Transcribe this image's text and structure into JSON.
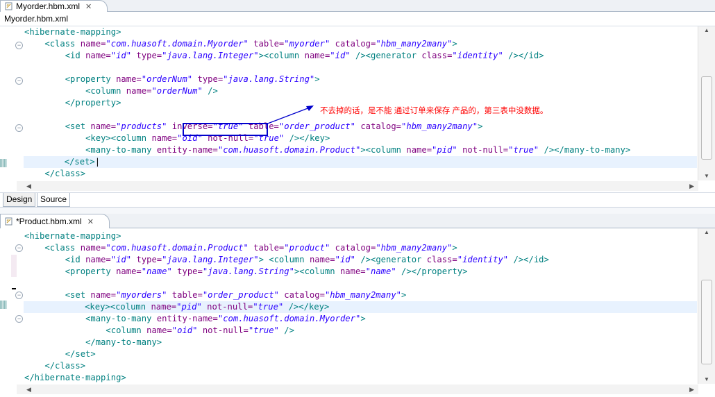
{
  "top_editor": {
    "tab_title": "Myorder.hbm.xml",
    "header_title": "Myorder.hbm.xml",
    "lines": [
      [
        [
          "tg",
          "<hibernate-mapping>"
        ]
      ],
      [
        [
          "pl",
          "    "
        ],
        [
          "tg",
          "<class "
        ],
        [
          "at",
          "name="
        ],
        [
          "st",
          "\"com.huasoft.domain.Myorder\""
        ],
        [
          "pl",
          " "
        ],
        [
          "at",
          "table="
        ],
        [
          "st",
          "\"myorder\""
        ],
        [
          "pl",
          " "
        ],
        [
          "at",
          "catalog="
        ],
        [
          "st",
          "\"hbm_many2many\""
        ],
        [
          "tg",
          ">"
        ]
      ],
      [
        [
          "pl",
          "        "
        ],
        [
          "tg",
          "<id "
        ],
        [
          "at",
          "name="
        ],
        [
          "st",
          "\"id\""
        ],
        [
          "pl",
          " "
        ],
        [
          "at",
          "type="
        ],
        [
          "st",
          "\"java.lang.Integer\""
        ],
        [
          "tg",
          "><column "
        ],
        [
          "at",
          "name="
        ],
        [
          "st",
          "\"id\""
        ],
        [
          "pl",
          " "
        ],
        [
          "tg",
          "/><generator "
        ],
        [
          "at",
          "class="
        ],
        [
          "st",
          "\"identity\""
        ],
        [
          "pl",
          " "
        ],
        [
          "tg",
          "/></id>"
        ]
      ],
      [
        [
          "pl",
          " "
        ]
      ],
      [
        [
          "pl",
          "        "
        ],
        [
          "tg",
          "<property "
        ],
        [
          "at",
          "name="
        ],
        [
          "st",
          "\"orderNum\""
        ],
        [
          "pl",
          " "
        ],
        [
          "at",
          "type="
        ],
        [
          "st",
          "\"java.lang.String\""
        ],
        [
          "tg",
          ">"
        ]
      ],
      [
        [
          "pl",
          "            "
        ],
        [
          "tg",
          "<column "
        ],
        [
          "at",
          "name="
        ],
        [
          "st",
          "\"orderNum\""
        ],
        [
          "pl",
          " "
        ],
        [
          "tg",
          "/>"
        ]
      ],
      [
        [
          "pl",
          "        "
        ],
        [
          "tg",
          "</property>"
        ]
      ],
      [
        [
          "pl",
          " "
        ]
      ],
      [
        [
          "pl",
          "        "
        ],
        [
          "tg",
          "<set "
        ],
        [
          "at",
          "name="
        ],
        [
          "st",
          "\"products\""
        ],
        [
          "pl",
          " "
        ],
        [
          "at",
          "inverse="
        ],
        [
          "st",
          "\"true\""
        ],
        [
          "pl",
          " "
        ],
        [
          "at",
          "table="
        ],
        [
          "st",
          "\"order_product\""
        ],
        [
          "pl",
          " "
        ],
        [
          "at",
          "catalog="
        ],
        [
          "st",
          "\"hbm_many2many\""
        ],
        [
          "tg",
          ">"
        ]
      ],
      [
        [
          "pl",
          "            "
        ],
        [
          "tg",
          "<key><column "
        ],
        [
          "at",
          "name="
        ],
        [
          "st",
          "\"oid\""
        ],
        [
          "pl",
          " "
        ],
        [
          "at",
          "not-null="
        ],
        [
          "st",
          "\"true\""
        ],
        [
          "pl",
          " "
        ],
        [
          "tg",
          "/></key>"
        ]
      ],
      [
        [
          "pl",
          "            "
        ],
        [
          "tg",
          "<many-to-many "
        ],
        [
          "at",
          "entity-name="
        ],
        [
          "st",
          "\"com.huasoft.domain.Product\""
        ],
        [
          "tg",
          "><column "
        ],
        [
          "at",
          "name="
        ],
        [
          "st",
          "\"pid\""
        ],
        [
          "pl",
          " "
        ],
        [
          "at",
          "not-null="
        ],
        [
          "st",
          "\"true\""
        ],
        [
          "pl",
          " "
        ],
        [
          "tg",
          "/></many-to-many>"
        ]
      ],
      [
        [
          "pl",
          "        "
        ],
        [
          "tg",
          "</set>"
        ],
        [
          "pl",
          "|"
        ]
      ],
      [
        [
          "pl",
          "    "
        ],
        [
          "tg",
          "</class>"
        ]
      ]
    ],
    "annotation": "不去掉的话，是不能 通过订单来保存 产品的，第三表中没数据。",
    "annotation_color": "#ff0000",
    "highlight_color": "#0000cc"
  },
  "bottom_tabs": {
    "design": "Design",
    "source": "Source"
  },
  "bottom_editor": {
    "tab_title": "*Product.hbm.xml",
    "lines": [
      [
        [
          "tg",
          "<hibernate-mapping>"
        ]
      ],
      [
        [
          "pl",
          "    "
        ],
        [
          "tg",
          "<class "
        ],
        [
          "at",
          "name="
        ],
        [
          "st",
          "\"com.huasoft.domain.Product\""
        ],
        [
          "pl",
          " "
        ],
        [
          "at",
          "table="
        ],
        [
          "st",
          "\"product\""
        ],
        [
          "pl",
          " "
        ],
        [
          "at",
          "catalog="
        ],
        [
          "st",
          "\"hbm_many2many\""
        ],
        [
          "tg",
          ">"
        ]
      ],
      [
        [
          "pl",
          "        "
        ],
        [
          "tg",
          "<id "
        ],
        [
          "at",
          "name="
        ],
        [
          "st",
          "\"id\""
        ],
        [
          "pl",
          " "
        ],
        [
          "at",
          "type="
        ],
        [
          "st",
          "\"java.lang.Integer\""
        ],
        [
          "tg",
          "> <column "
        ],
        [
          "at",
          "name="
        ],
        [
          "st",
          "\"id\""
        ],
        [
          "pl",
          " "
        ],
        [
          "tg",
          "/><generator "
        ],
        [
          "at",
          "class="
        ],
        [
          "st",
          "\"identity\""
        ],
        [
          "pl",
          " "
        ],
        [
          "tg",
          "/></id>"
        ]
      ],
      [
        [
          "pl",
          "        "
        ],
        [
          "tg",
          "<property "
        ],
        [
          "at",
          "name="
        ],
        [
          "st",
          "\"name\""
        ],
        [
          "pl",
          " "
        ],
        [
          "at",
          "type="
        ],
        [
          "st",
          "\"java.lang.String\""
        ],
        [
          "tg",
          "><column "
        ],
        [
          "at",
          "name="
        ],
        [
          "st",
          "\"name\""
        ],
        [
          "pl",
          " "
        ],
        [
          "tg",
          "/></property>"
        ]
      ],
      [
        [
          "pl",
          " "
        ]
      ],
      [
        [
          "pl",
          "        "
        ],
        [
          "tg",
          "<set "
        ],
        [
          "at",
          "name="
        ],
        [
          "st",
          "\"myorders\""
        ],
        [
          "pl",
          " "
        ],
        [
          "at",
          "table="
        ],
        [
          "st",
          "\"order_product\""
        ],
        [
          "pl",
          " "
        ],
        [
          "at",
          "catalog="
        ],
        [
          "st",
          "\"hbm_many2many\""
        ],
        [
          "tg",
          ">"
        ]
      ],
      [
        [
          "pl",
          "            "
        ],
        [
          "tg",
          "<key><column "
        ],
        [
          "at",
          "name="
        ],
        [
          "st",
          "\"pid\""
        ],
        [
          "pl",
          " "
        ],
        [
          "at",
          "not-null="
        ],
        [
          "st",
          "\"true\""
        ],
        [
          "pl",
          " "
        ],
        [
          "tg",
          "/></key>"
        ]
      ],
      [
        [
          "pl",
          "            "
        ],
        [
          "tg",
          "<many-to-many "
        ],
        [
          "at",
          "entity-name="
        ],
        [
          "st",
          "\"com.huasoft.domain.Myorder\""
        ],
        [
          "tg",
          ">"
        ]
      ],
      [
        [
          "pl",
          "                "
        ],
        [
          "tg",
          "<column "
        ],
        [
          "at",
          "name="
        ],
        [
          "st",
          "\"oid\""
        ],
        [
          "pl",
          " "
        ],
        [
          "at",
          "not-null="
        ],
        [
          "st",
          "\"true\""
        ],
        [
          "pl",
          " "
        ],
        [
          "tg",
          "/>"
        ]
      ],
      [
        [
          "pl",
          "            "
        ],
        [
          "tg",
          "</many-to-many>"
        ]
      ],
      [
        [
          "pl",
          "        "
        ],
        [
          "tg",
          "</set>"
        ]
      ],
      [
        [
          "pl",
          "    "
        ],
        [
          "tg",
          "</class>"
        ]
      ],
      [
        [
          "tg",
          "</hibernate-mapping>"
        ]
      ]
    ]
  }
}
